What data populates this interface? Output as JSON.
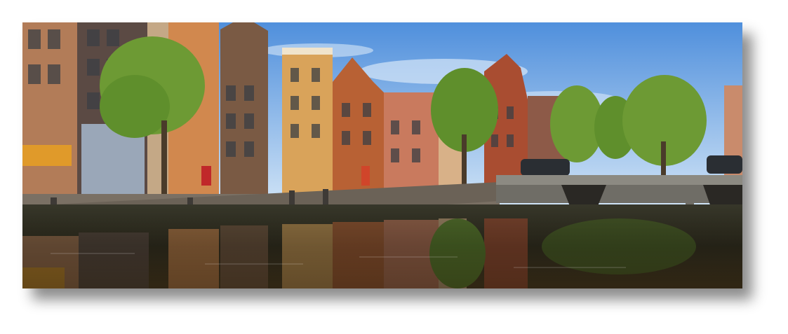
{
  "image": {
    "subject": "canal-houses-scene",
    "colors": {
      "sky_top": "#4f8fdc",
      "sky_bottom": "#cfe3f6",
      "water_dark": "#2d2a1c",
      "quay_wall": "#6b6257",
      "tree": "#5f8f2c",
      "bridge": "#8c8a82"
    }
  }
}
